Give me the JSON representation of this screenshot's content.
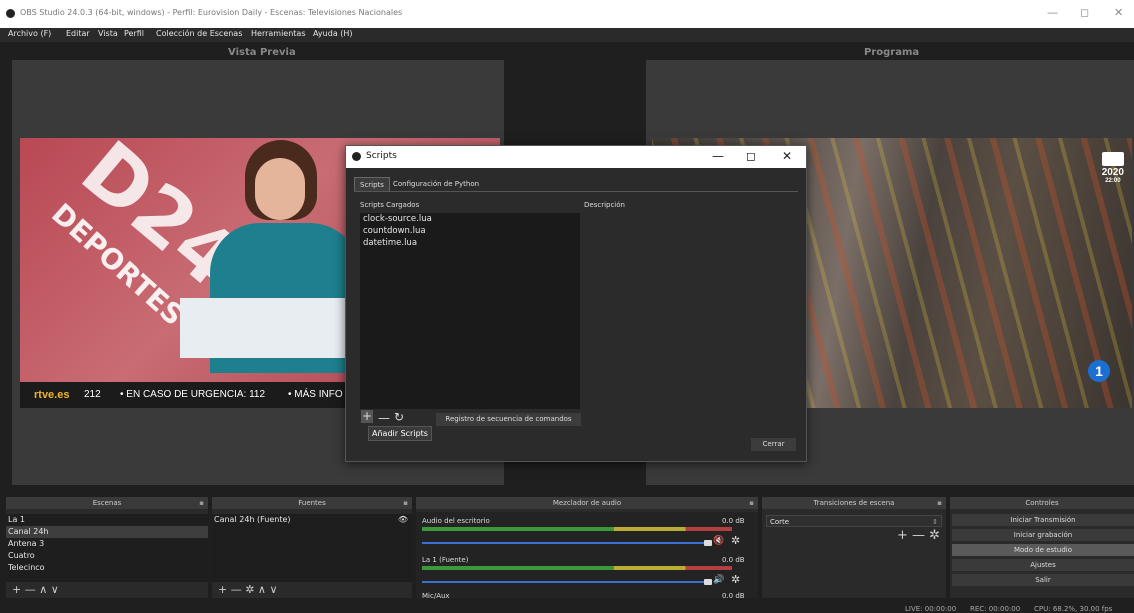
{
  "window": {
    "title": "OBS Studio 24.0.3 (64-bit, windows) - Perfil: Eurovision Daily - Escenas: Televisiones Nacionales",
    "minimize": "—",
    "maximize": "◻",
    "close": "✕"
  },
  "menu": {
    "items": [
      "Archivo (F)",
      "Editar",
      "Vista",
      "Perfil",
      "Colección de Escenas",
      "Herramientas",
      "Ayuda (H)"
    ]
  },
  "preview": {
    "title": "Vista Previa",
    "logo_big": "D24",
    "logo_sub": "DEPORTES",
    "ticker_logo": "rtve.es",
    "ticker_items": [
      "212",
      "•  EN CASO DE URGENCIA: 112",
      "•  MÁS INFO"
    ]
  },
  "program": {
    "title": "Programa",
    "badge_year": "2020",
    "badge_time": "22:00",
    "channel_num": "1"
  },
  "scripts_dialog": {
    "title": "Scripts",
    "tabs": [
      "Scripts",
      "Configuración de Python"
    ],
    "loaded_label": "Scripts Cargados",
    "description_label": "Descripción",
    "scripts": [
      "clock-source.lua",
      "countdown.lua",
      "datetime.lua"
    ],
    "add_icon": "+",
    "remove_icon": "—",
    "reload_icon": "↻",
    "log_button": "Registro de secuencia de comandos",
    "tooltip": "Añadir Scripts",
    "close_button": "Cerrar"
  },
  "docks": {
    "scenes": {
      "title": "Escenas",
      "items": [
        "La 1",
        "Canal 24h",
        "Antena 3",
        "Cuatro",
        "Telecinco"
      ],
      "footer": "+ —  ∧ ∨"
    },
    "sources": {
      "title": "Fuentes",
      "items": [
        "Canal 24h (Fuente)"
      ],
      "footer": "+ — ✲  ∧ ∨"
    },
    "mixer": {
      "title": "Mezclador de audio",
      "channels": [
        {
          "name": "Audio del escritorio",
          "db": "0.0 dB"
        },
        {
          "name": "La 1 (Fuente)",
          "db": "0.0 dB"
        },
        {
          "name": "Mic/Aux",
          "db": "0.0 dB"
        }
      ]
    },
    "transitions": {
      "title": "Transiciones de escena",
      "selected": "Corte",
      "footer": "+ — ✲"
    },
    "controls": {
      "title": "Controles",
      "buttons": [
        "Iniciar Transmisión",
        "Iniciar grabación",
        "Modo de estudio",
        "Ajustes",
        "Salir"
      ]
    }
  },
  "status": {
    "live": "LIVE: 00:00:00",
    "rec": "REC: 00:00:00",
    "cpu": "CPU: 68.2%, 30.00 fps"
  },
  "colors": {
    "accent": "#3a6fd6",
    "bg": "#1f1f1f",
    "panel": "#2a2a2a"
  }
}
